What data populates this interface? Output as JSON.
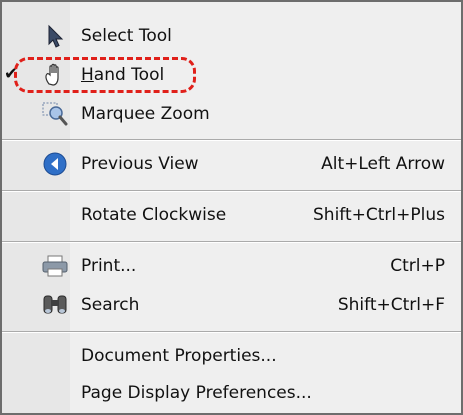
{
  "menu": {
    "items": [
      {
        "label": "Select Tool",
        "shortcut": "",
        "icon": "arrow-pointer-icon",
        "checked": false
      },
      {
        "label": "Hand Tool",
        "shortcut": "",
        "icon": "hand-icon",
        "checked": true
      },
      {
        "label": "Marquee Zoom",
        "shortcut": "",
        "icon": "marquee-zoom-icon",
        "checked": false
      },
      {
        "label": "Previous View",
        "shortcut": "Alt+Left Arrow",
        "icon": "previous-view-icon",
        "checked": false
      },
      {
        "label": "Rotate Clockwise",
        "shortcut": "Shift+Ctrl+Plus",
        "icon": "",
        "checked": false
      },
      {
        "label": "Print...",
        "shortcut": "Ctrl+P",
        "icon": "printer-icon",
        "checked": false
      },
      {
        "label": "Search",
        "shortcut": "Shift+Ctrl+F",
        "icon": "binoculars-icon",
        "checked": false
      },
      {
        "label": "Document Properties...",
        "shortcut": "",
        "icon": "",
        "checked": false
      },
      {
        "label": "Page Display Preferences...",
        "shortcut": "",
        "icon": "",
        "checked": false
      }
    ],
    "check_mark": "✔"
  },
  "colors": {
    "menu_background": "#efefef",
    "highlight_outline": "#e0201a",
    "icon_blue": "#2f6fc7"
  }
}
